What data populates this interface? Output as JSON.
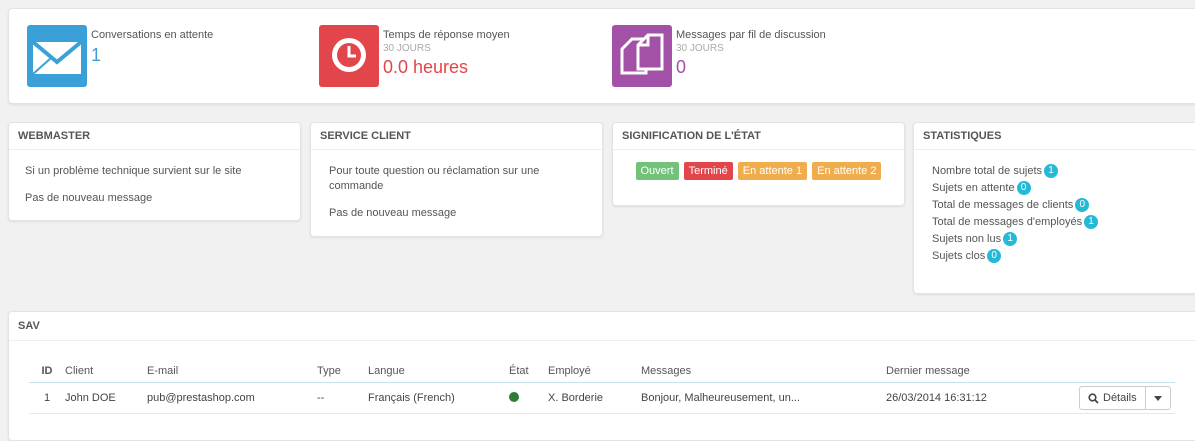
{
  "kpis": [
    {
      "label": "Conversations en attente",
      "sub": "",
      "value": "1",
      "color": "#3aa0d8",
      "value_color": "#3aa0d8",
      "icon": "envelope-icon"
    },
    {
      "label": "Temps de réponse moyen",
      "sub": "30 JOURS",
      "value": "0.0 heures",
      "color": "#e3464a",
      "value_color": "#e3464a",
      "icon": "clock-icon"
    },
    {
      "label": "Messages par fil de discussion",
      "sub": "30 JOURS",
      "value": "0",
      "color": "#a351a6",
      "value_color": "#a351a6",
      "icon": "documents-icon"
    }
  ],
  "webmaster": {
    "title": "WEBMASTER",
    "desc": "Si un problème technique survient sur le site",
    "status": "Pas de nouveau message"
  },
  "service_client": {
    "title": "SERVICE CLIENT",
    "desc": "Pour toute question ou réclamation sur une commande",
    "status": "Pas de nouveau message"
  },
  "signification": {
    "title": "SIGNIFICATION DE L'ÉTAT",
    "tags": [
      {
        "label": "Ouvert",
        "color": "#72c279"
      },
      {
        "label": "Terminé",
        "color": "#e3464a"
      },
      {
        "label": "En attente 1",
        "color": "#f0ad4e"
      },
      {
        "label": "En attente 2",
        "color": "#f0ad4e"
      }
    ]
  },
  "statistiques": {
    "title": "STATISTIQUES",
    "badge_color": "#25b9d7",
    "items": [
      {
        "label": "Nombre total de sujets",
        "count": "1"
      },
      {
        "label": "Sujets en attente",
        "count": "0"
      },
      {
        "label": "Total de messages de clients",
        "count": "0"
      },
      {
        "label": "Total de messages d'employés",
        "count": "1"
      },
      {
        "label": "Sujets non lus",
        "count": "1"
      },
      {
        "label": "Sujets clos",
        "count": "0"
      }
    ]
  },
  "sav": {
    "title": "SAV",
    "columns": [
      "ID",
      "Client",
      "E-mail",
      "Type",
      "Langue",
      "État",
      "Employé",
      "Messages",
      "Dernier message"
    ],
    "rows": [
      {
        "id": "1",
        "client": "John DOE",
        "email": "pub@prestashop.com",
        "type": "--",
        "langue": "Français (French)",
        "etat_color": "#2e7d32",
        "employe": "X. Borderie",
        "messages": "Bonjour, Malheureusement, un...",
        "dernier": "26/03/2014 16:31:12"
      }
    ],
    "details_label": "Détails"
  }
}
